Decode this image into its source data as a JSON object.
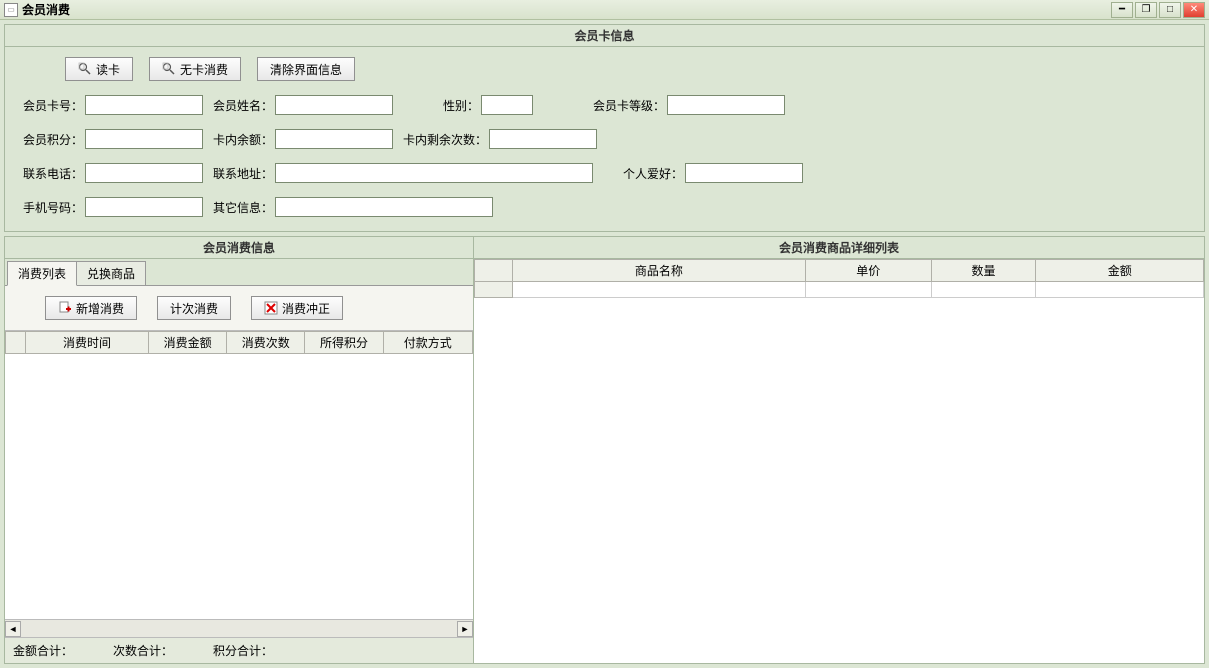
{
  "window": {
    "title": "会员消费"
  },
  "card_info": {
    "title": "会员卡信息",
    "buttons": {
      "read_card": "读卡",
      "no_card": "无卡消费",
      "clear": "清除界面信息"
    },
    "labels": {
      "card_no": "会员卡号：",
      "name": "会员姓名：",
      "gender": "性别：",
      "level": "会员卡等级：",
      "points": "会员积分：",
      "balance": "卡内余额：",
      "remain_times": "卡内剩余次数：",
      "contact_phone": "联系电话：",
      "contact_addr": "联系地址：",
      "hobby": "个人爱好：",
      "mobile": "手机号码：",
      "other": "其它信息："
    },
    "values": {
      "card_no": "",
      "name": "",
      "gender": "",
      "level": "",
      "points": "",
      "balance": "",
      "remain_times": "",
      "contact_phone": "",
      "contact_addr": "",
      "hobby": "",
      "mobile": "",
      "other": ""
    }
  },
  "consume_info": {
    "title": "会员消费信息",
    "tabs": {
      "consume_list": "消费列表",
      "exchange": "兑换商品"
    },
    "buttons": {
      "new_consume": "新增消费",
      "count_consume": "计次消费",
      "reverse": "消费冲正"
    },
    "columns": {
      "time": "消费时间",
      "amount": "消费金额",
      "count": "消费次数",
      "points": "所得积分",
      "pay_method": "付款方式"
    },
    "footer": {
      "amount_total": "金额合计：",
      "count_total": "次数合计：",
      "points_total": "积分合计："
    }
  },
  "detail_list": {
    "title": "会员消费商品详细列表",
    "columns": {
      "product": "商品名称",
      "price": "单价",
      "qty": "数量",
      "amount": "金额"
    }
  }
}
